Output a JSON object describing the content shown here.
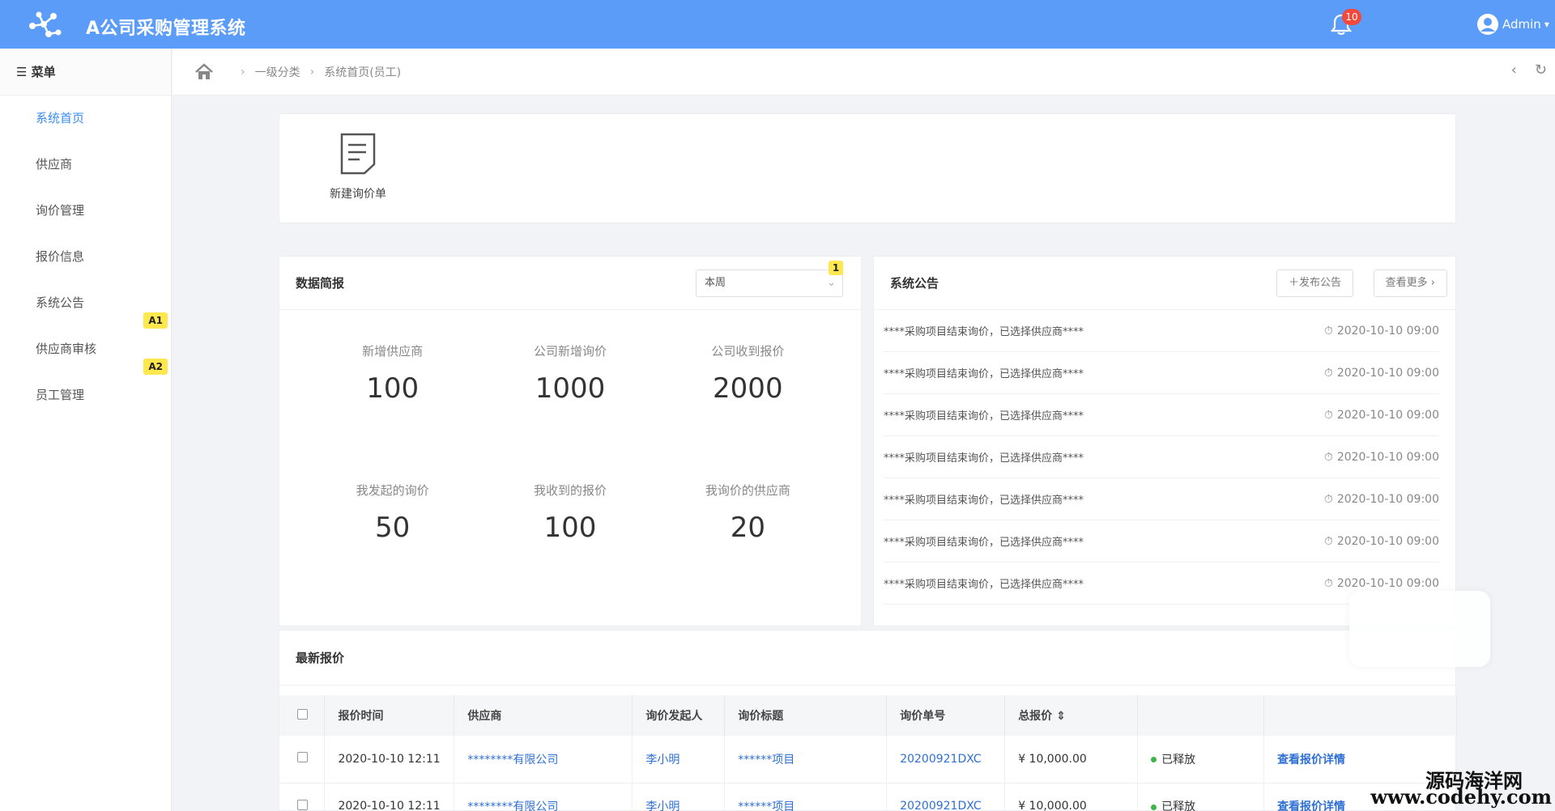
{
  "app": {
    "title": "A公司采购管理系统",
    "notification_count": "10",
    "user_name": "Admin"
  },
  "sidebar": {
    "header": "☰ 菜单",
    "items": [
      {
        "label": "系统首页",
        "active": true
      },
      {
        "label": "供应商"
      },
      {
        "label": "询价管理"
      },
      {
        "label": "报价信息"
      },
      {
        "label": "系统公告",
        "tag": "A1"
      },
      {
        "label": "供应商审核",
        "tag": "A2"
      },
      {
        "label": "员工管理"
      }
    ]
  },
  "breadcrumb": {
    "level1": "一级分类",
    "level2": "系统首页(员工)"
  },
  "quick": {
    "new_inquiry_label": "新建询价单"
  },
  "stats": {
    "title": "数据简报",
    "period_value": "本周",
    "period_badge": "1",
    "items": [
      {
        "label": "新增供应商",
        "value": "100"
      },
      {
        "label": "公司新增询价",
        "value": "1000"
      },
      {
        "label": "公司收到报价",
        "value": "2000"
      },
      {
        "label": "我发起的询价",
        "value": "50"
      },
      {
        "label": "我收到的报价",
        "value": "100"
      },
      {
        "label": "我询价的供应商",
        "value": "20"
      }
    ]
  },
  "notice": {
    "title": "系统公告",
    "publish_label": "发布公告",
    "more_label": "查看更多",
    "items": [
      {
        "text": "****采购项目结束询价，已选择供应商****",
        "time": "2020-10-10 09:00"
      },
      {
        "text": "****采购项目结束询价，已选择供应商****",
        "time": "2020-10-10 09:00"
      },
      {
        "text": "****采购项目结束询价，已选择供应商****",
        "time": "2020-10-10 09:00"
      },
      {
        "text": "****采购项目结束询价，已选择供应商****",
        "time": "2020-10-10 09:00"
      },
      {
        "text": "****采购项目结束询价，已选择供应商****",
        "time": "2020-10-10 09:00"
      },
      {
        "text": "****采购项目结束询价，已选择供应商****",
        "time": "2020-10-10 09:00"
      },
      {
        "text": "****采购项目结束询价，已选择供应商****",
        "time": "2020-10-10 09:00"
      }
    ]
  },
  "latest": {
    "title": "最新报价",
    "columns": [
      "报价时间",
      "供应商",
      "询价发起人",
      "询价标题",
      "询价单号",
      "总报价 ⇕"
    ],
    "rows": [
      {
        "time": "2020-10-10 12:11",
        "supplier": "********有限公司",
        "initiator": "李小明",
        "subject": "******项目",
        "number": "20200921DXC",
        "total": "¥ 10,000.00",
        "status": "已释放",
        "action": "查看报价详情"
      },
      {
        "time": "2020-10-10 12:11",
        "supplier": "********有限公司",
        "initiator": "李小明",
        "subject": "******项目",
        "number": "20200921DXC",
        "total": "¥ 10,000.00",
        "status": "已释放",
        "action": "查看报价详情"
      }
    ]
  },
  "watermark": {
    "line1": "源码海洋网",
    "line2": "www.codehy.com"
  },
  "colors": {
    "topbar": "#5a9cf8",
    "accent": "#3b8cf0",
    "link": "#2e6fd6",
    "badge": "#f3483a",
    "tag": "#ffe84d",
    "status": "#3bb54a"
  }
}
